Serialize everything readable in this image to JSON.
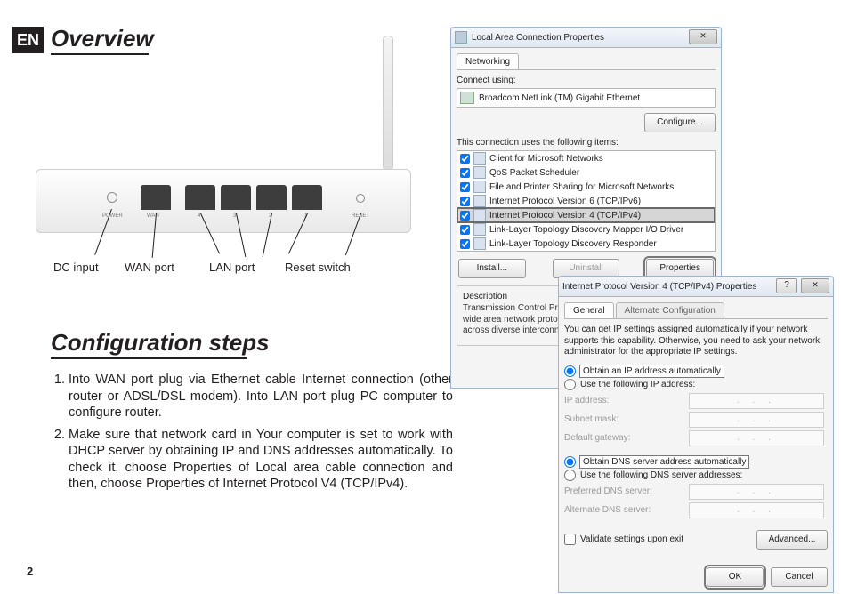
{
  "lang": "EN",
  "headings": {
    "overview": "Overview",
    "config": "Configuration steps"
  },
  "router_labels": {
    "power": "POWER",
    "wan": "WAN",
    "p4": "4",
    "p3": "3",
    "p2": "2",
    "p1": "1",
    "reset": "RESET",
    "dc_input": "DC input",
    "wan_port": "WAN port",
    "lan_port": "LAN port",
    "reset_switch": "Reset switch"
  },
  "steps": [
    "Into WAN port plug via Ethernet cable Internet connection (other router or ADSL/DSL modem). Into LAN port plug PC computer to configure router.",
    "Make sure that network card in Your computer is set to work with DHCP server by obtaining IP and DNS addresses automatically. To check it, choose Properties of Local area cable connection and then, choose Properties of Internet Protocol V4 (TCP/IPv4)."
  ],
  "page_number": "2",
  "lacp": {
    "title": "Local Area Connection Properties",
    "tab": "Networking",
    "connect_using_label": "Connect using:",
    "adapter": "Broadcom NetLink (TM) Gigabit Ethernet",
    "configure_btn": "Configure...",
    "items_label": "This connection uses the following items:",
    "items": [
      "Client for Microsoft Networks",
      "QoS Packet Scheduler",
      "File and Printer Sharing for Microsoft Networks",
      "Internet Protocol Version 6 (TCP/IPv6)",
      "Internet Protocol Version 4 (TCP/IPv4)",
      "Link-Layer Topology Discovery Mapper I/O Driver",
      "Link-Layer Topology Discovery Responder"
    ],
    "install_btn": "Install...",
    "uninstall_btn": "Uninstall",
    "properties_btn": "Properties",
    "desc_heading": "Description",
    "desc_text": "Transmission Control Protocol/Internet Protocol. The default wide area network protocol that provides communication across diverse interconnected networks."
  },
  "ipv4": {
    "title": "Internet Protocol Version 4 (TCP/IPv4) Properties",
    "tab_general": "General",
    "tab_alt": "Alternate Configuration",
    "blurb": "You can get IP settings assigned automatically if your network supports this capability. Otherwise, you need to ask your network administrator for the appropriate IP settings.",
    "r_auto_ip": "Obtain an IP address automatically",
    "r_manual_ip": "Use the following IP address:",
    "f_ip": "IP address:",
    "f_subnet": "Subnet mask:",
    "f_gw": "Default gateway:",
    "r_auto_dns": "Obtain DNS server address automatically",
    "r_manual_dns": "Use the following DNS server addresses:",
    "f_pref_dns": "Preferred DNS server:",
    "f_alt_dns": "Alternate DNS server:",
    "validate": "Validate settings upon exit",
    "advanced_btn": "Advanced...",
    "ok_btn": "OK",
    "cancel_btn": "Cancel",
    "ip_placeholder": ".   .   ."
  }
}
